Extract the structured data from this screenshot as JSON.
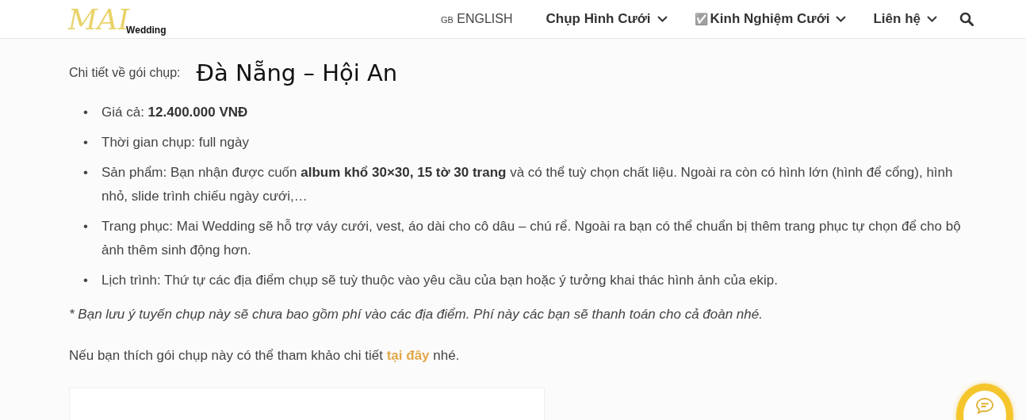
{
  "header": {
    "logo": {
      "script": "MAI",
      "sub": "Wedding"
    },
    "language": {
      "flag": "GB",
      "label": "ENGLISH"
    },
    "nav": [
      {
        "label": "Chụp Hình Cưới",
        "dropdown": true
      },
      {
        "mark": "✅",
        "label": "Kinh Nghiệm Cưới",
        "dropdown": true
      },
      {
        "label": "Liên hệ",
        "dropdown": true
      }
    ]
  },
  "package": {
    "label": "Chi tiết về gói chụp:",
    "name": "Đà Nẵng – Hội An"
  },
  "details": [
    {
      "bullet": "•",
      "text": "Giá cả: **12.400.000 VNĐ**"
    },
    {
      "bullet": "•",
      "text": "Thời gian chụp: full ngày"
    },
    {
      "bullet": "•",
      "text": "Sản phẩm: Bạn nhận được cuốn **album khổ 30×30, 15 tờ 30 trang** và có thể tuỳ chọn chất liệu. Ngoài ra còn có hình lớn (hình để cổng), hình nhỏ, slide trình chiếu ngày cưới,…"
    },
    {
      "bullet": "•",
      "text": "Trang phục: Mai Wedding sẽ hỗ trợ váy cưới, vest, áo dài cho cô dâu – chú rể. Ngoài ra bạn có thể chuẩn bị thêm trang phục tự chọn để cho bộ ảnh thêm sinh động hơn."
    },
    {
      "bullet": "•",
      "text": "Lịch trình: Thứ tự các địa điểm chụp sẽ tuỳ thuộc vào yêu cầu của bạn hoặc ý tưởng khai thác hình ảnh của ekip."
    }
  ],
  "note": "* Bạn lưu ý tuyến chụp này sẽ chưa bao gồm phí vào các địa điểm. Phí này các bạn sẽ thanh toán cho cả đoàn nhé.",
  "reference": {
    "before": "Nếu bạn thích gói chụp này có thể tham khảo chi tiết",
    "link": "tại đây",
    "after": "nhé."
  }
}
